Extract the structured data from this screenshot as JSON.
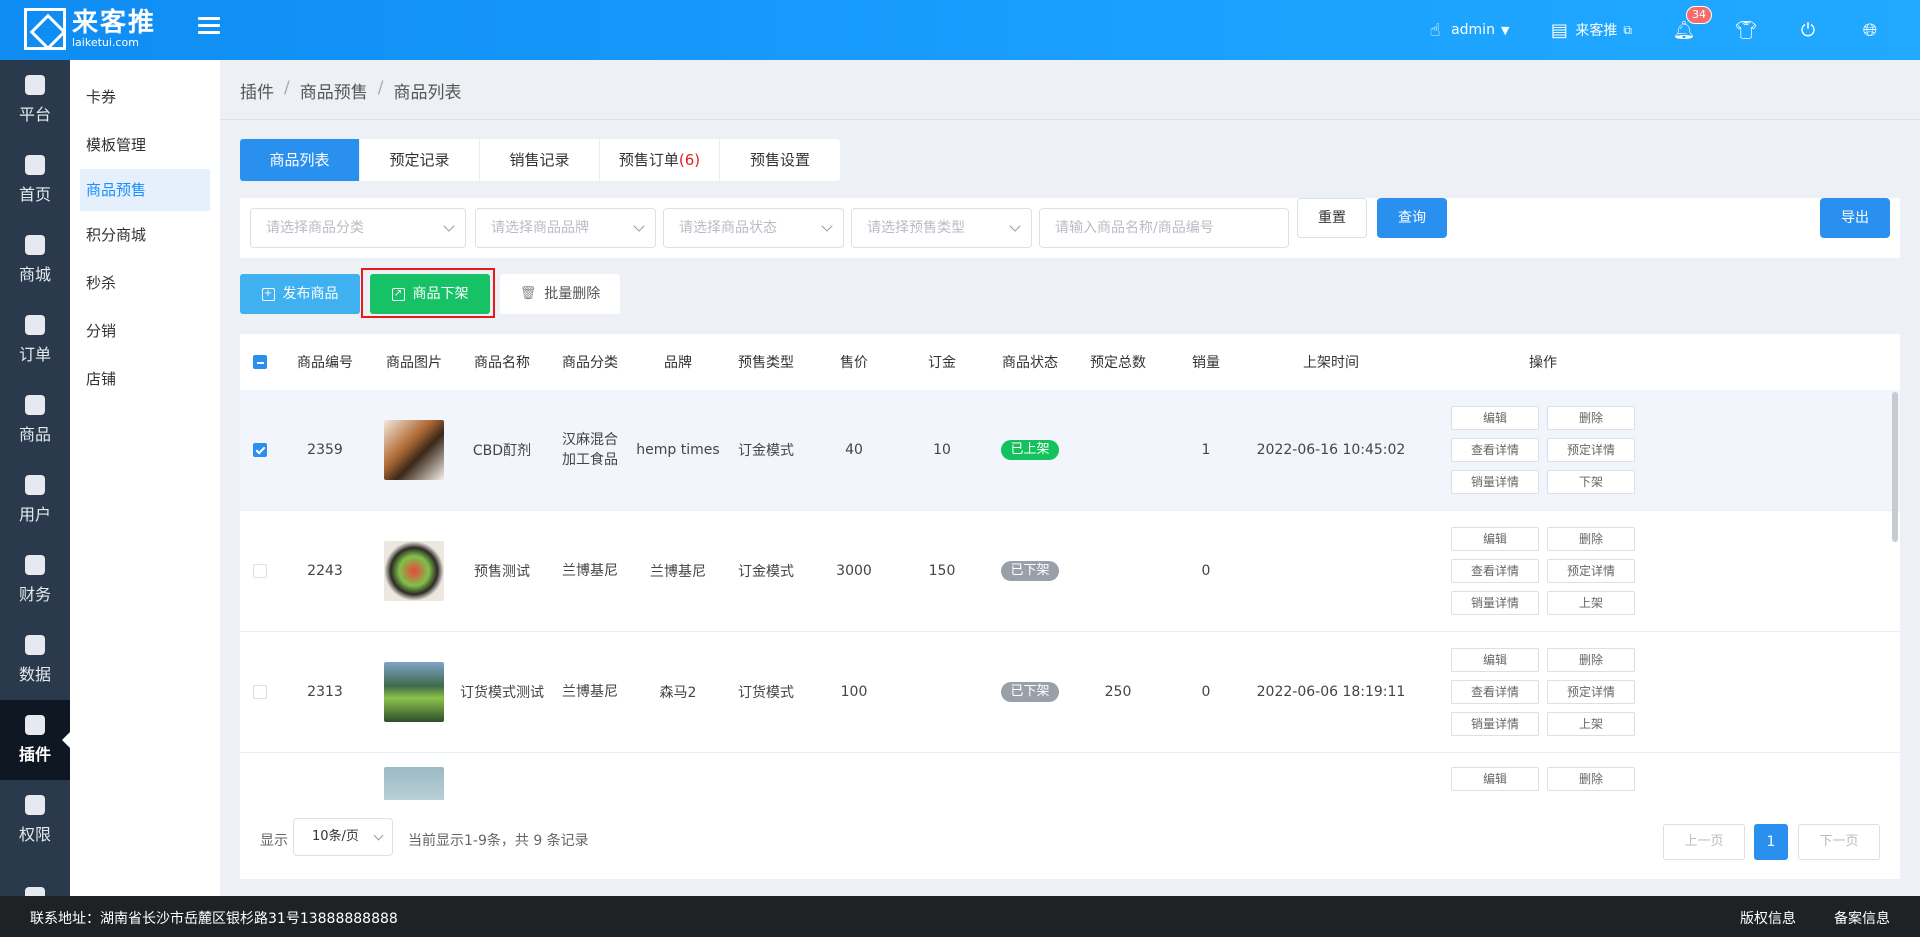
{
  "header": {
    "logo_cn": "来客推",
    "logo_en": "laiketui.com",
    "user": "admin",
    "store": "来客推",
    "notifications": "34"
  },
  "nav": [
    {
      "label": "平台",
      "icon": "platform-icon"
    },
    {
      "label": "首页",
      "icon": "home-icon"
    },
    {
      "label": "商城",
      "icon": "mall-icon"
    },
    {
      "label": "订单",
      "icon": "order-icon"
    },
    {
      "label": "商品",
      "icon": "goods-icon"
    },
    {
      "label": "用户",
      "icon": "user-icon"
    },
    {
      "label": "财务",
      "icon": "wallet-icon"
    },
    {
      "label": "数据",
      "icon": "pie-chart-icon"
    },
    {
      "label": "插件",
      "icon": "puzzle-icon",
      "active": true
    },
    {
      "label": "权限",
      "icon": "shield-icon"
    },
    {
      "label": "",
      "icon": "image-icon"
    }
  ],
  "submenu": [
    "卡券",
    "模板管理",
    "商品预售",
    "积分商城",
    "秒杀",
    "分销",
    "店铺"
  ],
  "breadcrumb": [
    "插件",
    "商品预售",
    "商品列表"
  ],
  "tabs": [
    {
      "label": "商品列表"
    },
    {
      "label": "预定记录"
    },
    {
      "label": "销售记录"
    },
    {
      "label": "预售订单",
      "count": "(6)"
    },
    {
      "label": "预售设置"
    }
  ],
  "filters": {
    "category_placeholder": "请选择商品分类",
    "brand_placeholder": "请选择商品品牌",
    "status_placeholder": "请选择商品状态",
    "type_placeholder": "请选择预售类型",
    "keyword_placeholder": "请输入商品名称/商品编号",
    "reset": "重置",
    "search": "查询",
    "export": "导出"
  },
  "actions": {
    "publish": "发布商品",
    "unlist": "商品下架",
    "batch_delete": "批量删除"
  },
  "table": {
    "headers": [
      "商品编号",
      "商品图片",
      "商品名称",
      "商品分类",
      "品牌",
      "预售类型",
      "售价",
      "订金",
      "商品状态",
      "预定总数",
      "销量",
      "上架时间",
      "操作"
    ],
    "rows": [
      {
        "id": "2359",
        "name": "CBD酊剂",
        "category": "汉麻混合加工食品",
        "brand": "hemp times",
        "type": "订金模式",
        "price": "40",
        "deposit": "10",
        "status": "已上架",
        "reserved": "",
        "sales": "1",
        "time": "2022-06-16 10:45:02",
        "ops": [
          "编辑",
          "删除",
          "查看详情",
          "预定详情",
          "销量详情",
          "下架"
        ]
      },
      {
        "id": "2243",
        "name": "预售测试",
        "category": "兰博基尼",
        "brand": "兰博基尼",
        "type": "订金模式",
        "price": "3000",
        "deposit": "150",
        "status": "已下架",
        "reserved": "",
        "sales": "0",
        "time": "",
        "ops": [
          "编辑",
          "删除",
          "查看详情",
          "预定详情",
          "销量详情",
          "上架"
        ]
      },
      {
        "id": "2313",
        "name": "订货模式测试",
        "category": "兰博基尼",
        "brand": "森马2",
        "type": "订货模式",
        "price": "100",
        "deposit": "",
        "status": "已下架",
        "reserved": "250",
        "sales": "0",
        "time": "2022-06-06 18:19:11",
        "ops": [
          "编辑",
          "删除",
          "查看详情",
          "预定详情",
          "销量详情",
          "上架"
        ]
      },
      {
        "id": "",
        "name": "",
        "category": "",
        "brand": "",
        "type": "",
        "price": "",
        "deposit": "",
        "status": "",
        "reserved": "",
        "sales": "",
        "time": "",
        "ops": [
          "编辑",
          "删除"
        ]
      }
    ]
  },
  "pager": {
    "show_label": "显示",
    "page_size": "10条/页",
    "info": "当前显示1-9条，共 9 条记录",
    "prev": "上一页",
    "current": "1",
    "next": "下一页"
  },
  "footer": {
    "address": "联系地址：湖南省长沙市岳麓区银杉路31号13888888888",
    "copyright": "版权信息",
    "record": "备案信息"
  },
  "colors": {
    "primary": "#2990f0",
    "success": "#13c25d",
    "publish": "#3fb0f0",
    "highlight": "#e81b1b"
  }
}
